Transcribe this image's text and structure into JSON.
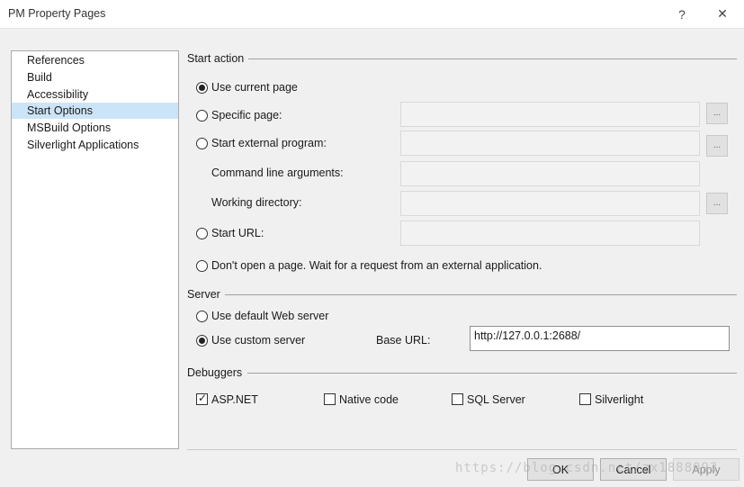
{
  "window": {
    "title": "PM Property Pages",
    "help_glyph": "?",
    "close_glyph": "✕"
  },
  "nav": {
    "items": [
      {
        "label": "References"
      },
      {
        "label": "Build"
      },
      {
        "label": "Accessibility"
      },
      {
        "label": "Start Options",
        "selected": true
      },
      {
        "label": "MSBuild Options"
      },
      {
        "label": "Silverlight Applications"
      }
    ]
  },
  "start_action": {
    "group_label": "Start action",
    "use_current_page": "Use current page",
    "specific_page": "Specific page:",
    "start_external_program": "Start external program:",
    "command_line_arguments": "Command line arguments:",
    "working_directory": "Working directory:",
    "start_url": "Start URL:",
    "dont_open": "Don't open a page. Wait for a request from an external application.",
    "browse_label": "...",
    "selected": "use_current_page"
  },
  "server": {
    "group_label": "Server",
    "use_default": "Use default Web server",
    "use_custom": "Use custom server",
    "base_url_label": "Base URL:",
    "base_url_value": "http://127.0.0.1:2688/",
    "selected": "use_custom"
  },
  "debuggers": {
    "group_label": "Debuggers",
    "asp_net": "ASP.NET",
    "native_code": "Native code",
    "sql_server": "SQL Server",
    "silverlight": "Silverlight",
    "check_glyph": "✓"
  },
  "buttons": {
    "ok": "OK",
    "cancel": "Cancel",
    "apply": "Apply"
  },
  "watermark": "https://blog.csdn.net/zx1888093"
}
